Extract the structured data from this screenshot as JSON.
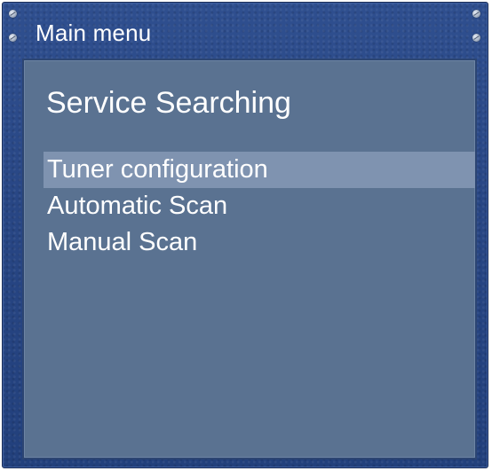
{
  "header": {
    "title": "Main menu"
  },
  "panel": {
    "title": "Service Searching"
  },
  "menu": {
    "items": [
      {
        "label": "Tuner configuration",
        "selected": true
      },
      {
        "label": "Automatic Scan",
        "selected": false
      },
      {
        "label": "Manual Scan",
        "selected": false
      }
    ]
  },
  "colors": {
    "frame": "#284684",
    "panel": "#5a7291",
    "selection": "#7f93b0",
    "text": "#ffffff"
  },
  "icons": [
    "screw-icon"
  ]
}
